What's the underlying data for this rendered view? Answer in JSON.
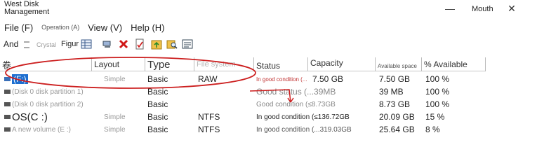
{
  "window": {
    "title": "West Disk Management",
    "user": "Mouth",
    "minimize_glyph": "—",
    "maximize_glyph": "☐",
    "close_glyph": "✕"
  },
  "menu": {
    "file": "File (F)",
    "operation": "Operation (A)",
    "view": "View (V)",
    "help": "Help (H)"
  },
  "toolbar": {
    "and_label": "And",
    "crystal_label": "Crystal",
    "figure_label": "Figur"
  },
  "columns": {
    "volume": "卷",
    "layout": "Layout",
    "type": "Type",
    "file_system": "File system",
    "status": "Status",
    "capacity": "Capacity",
    "available_space": "Available space",
    "percent_available": "% Available"
  },
  "rows": [
    {
      "volume": "(F:)",
      "layout": "Simple",
      "type": "Basic",
      "file_system": "RAW",
      "status": "In good condition (...",
      "capacity": "7.50 GB",
      "available": "7.50 GB",
      "percent": "100 %"
    },
    {
      "volume": "(Disk 0 disk partition 1)",
      "layout": "simple",
      "type": "Basic",
      "file_system": "",
      "status": "Good status (...39MB",
      "capacity": "",
      "available": "39 MB",
      "percent": "100 %"
    },
    {
      "volume": "(Disk 0 disk partition 2)",
      "layout": "simple",
      "type": "Basic",
      "file_system": "",
      "status": "Good condition (≤8.73GB",
      "capacity": "",
      "available": "8.73 GB",
      "percent": "100 %"
    },
    {
      "volume": "OS(C :)",
      "layout": "Simple",
      "type": "Basic",
      "file_system": "NTFS",
      "status": "In good condition (≤136.72GB",
      "capacity": "",
      "available": "20.09 GB",
      "percent": "15 %"
    },
    {
      "volume": "A new volume (E :)",
      "layout": "Simple",
      "type": "Basic",
      "file_system": "NTFS",
      "status": "In good condition (...319.03GB",
      "capacity": "",
      "available": "25.64 GB",
      "percent": "8 %"
    }
  ],
  "colors": {
    "annotation": "#cc1f1f",
    "selected": "#1e6fd0"
  }
}
